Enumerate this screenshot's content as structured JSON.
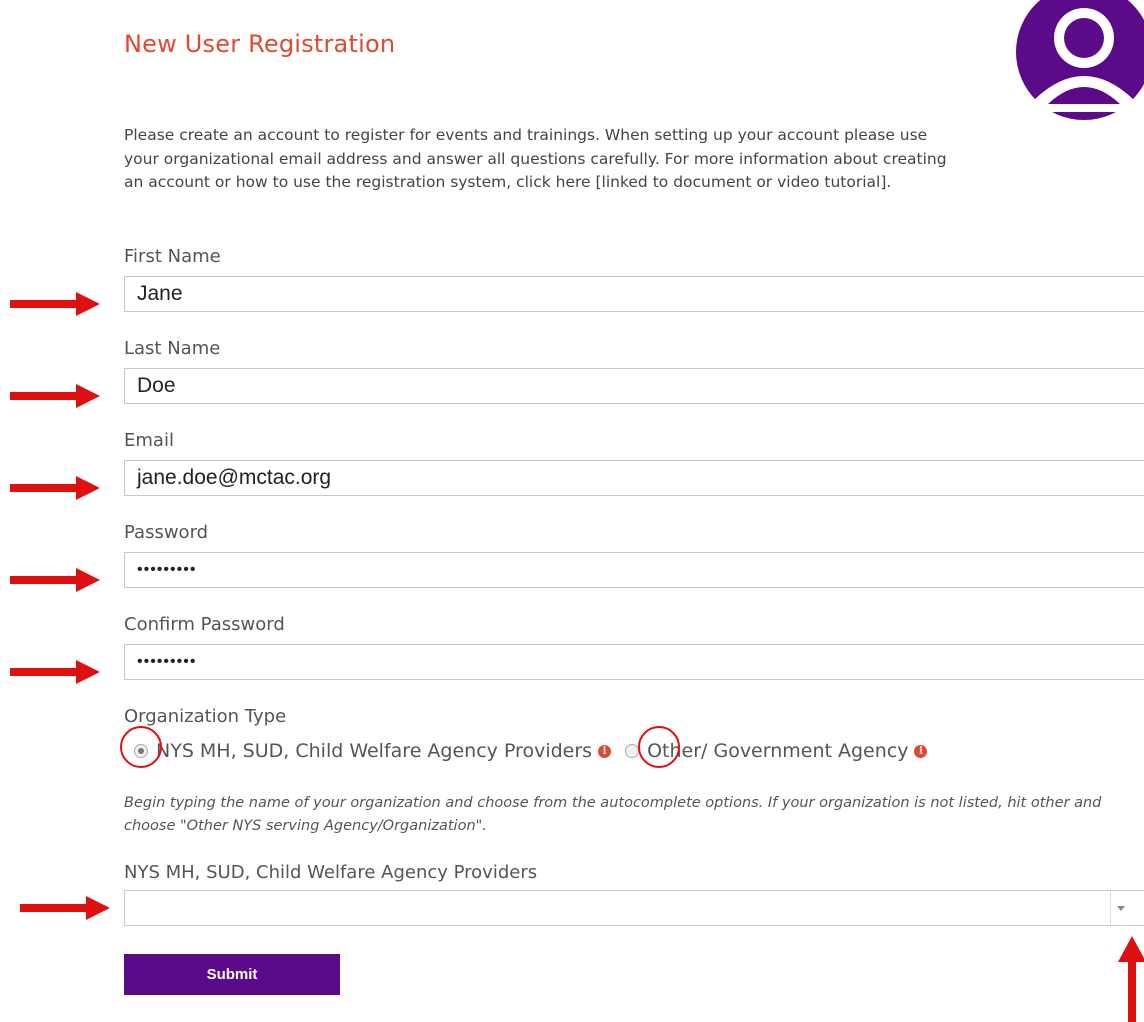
{
  "page": {
    "title": "New User Registration"
  },
  "intro": "Please create an account to register for events and trainings. When setting up your account please use your organizational email address and answer all questions carefully. For more information about creating an account or how to use the registration system, click here [linked to document or video tutorial].",
  "form": {
    "first_name": {
      "label": "First Name",
      "value": "Jane"
    },
    "last_name": {
      "label": "Last Name",
      "value": "Doe"
    },
    "email": {
      "label": "Email",
      "value": "jane.doe@mctac.org"
    },
    "password": {
      "label": "Password",
      "value": "•••••••••"
    },
    "confirm_password": {
      "label": "Confirm Password",
      "value": "•••••••••"
    },
    "organization_type": {
      "label": "Organization Type",
      "options": [
        {
          "label": "NYS MH, SUD, Child Welfare Agency Providers",
          "selected": true
        },
        {
          "label": "Other/ Government Agency",
          "selected": false
        }
      ]
    },
    "help_text": "Begin typing the name of your organization and choose from the autocomplete options. If your organization is not listed, hit other and choose \"Other NYS serving Agency/Organization\".",
    "provider_select": {
      "label": "NYS MH, SUD, Child Welfare Agency Providers",
      "value": ""
    },
    "submit_label": "Submit"
  },
  "icons": {
    "avatar": "user-avatar-icon",
    "info": "info-icon",
    "annotation_arrow": "red-arrow-icon"
  },
  "colors": {
    "title": "#e0492f",
    "avatar": "#5b0a8a",
    "submit": "#5b0a8a",
    "annotation": "#e01010"
  }
}
